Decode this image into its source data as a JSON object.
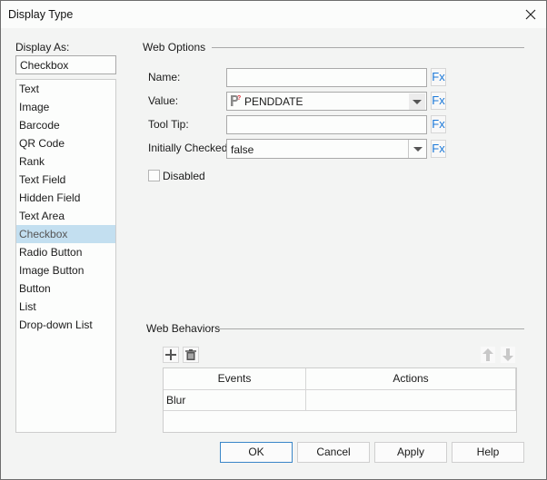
{
  "window": {
    "title": "Display Type",
    "close_icon": "close-icon"
  },
  "display_as": {
    "label": "Display As:",
    "current_value": "Checkbox",
    "items": [
      {
        "label": "Text",
        "selected": false
      },
      {
        "label": "Image",
        "selected": false
      },
      {
        "label": "Barcode",
        "selected": false
      },
      {
        "label": "QR Code",
        "selected": false
      },
      {
        "label": "Rank",
        "selected": false
      },
      {
        "label": "Text Field",
        "selected": false
      },
      {
        "label": "Hidden Field",
        "selected": false
      },
      {
        "label": "Text Area",
        "selected": false
      },
      {
        "label": "Checkbox",
        "selected": true
      },
      {
        "label": "Radio Button",
        "selected": false
      },
      {
        "label": "Image Button",
        "selected": false
      },
      {
        "label": "Button",
        "selected": false
      },
      {
        "label": "List",
        "selected": false
      },
      {
        "label": "Drop-down List",
        "selected": false
      }
    ]
  },
  "web_options": {
    "group_label": "Web Options",
    "name": {
      "label": "Name:",
      "value": ""
    },
    "value": {
      "label": "Value:",
      "value": "PENDDATE",
      "icon": "parameter-icon"
    },
    "tool_tip": {
      "label": "Tool Tip:",
      "value": ""
    },
    "initially_checked": {
      "label": "Initially Checked:",
      "value": "false"
    },
    "disabled": {
      "label": "Disabled",
      "checked": false
    },
    "fx_label": "Fx"
  },
  "web_behaviors": {
    "group_label": "Web Behaviors",
    "columns": [
      "Events",
      "Actions"
    ],
    "rows": [
      {
        "event": "Blur",
        "action": ""
      }
    ]
  },
  "footer": {
    "ok": "OK",
    "cancel": "Cancel",
    "apply": "Apply",
    "help": "Help"
  }
}
